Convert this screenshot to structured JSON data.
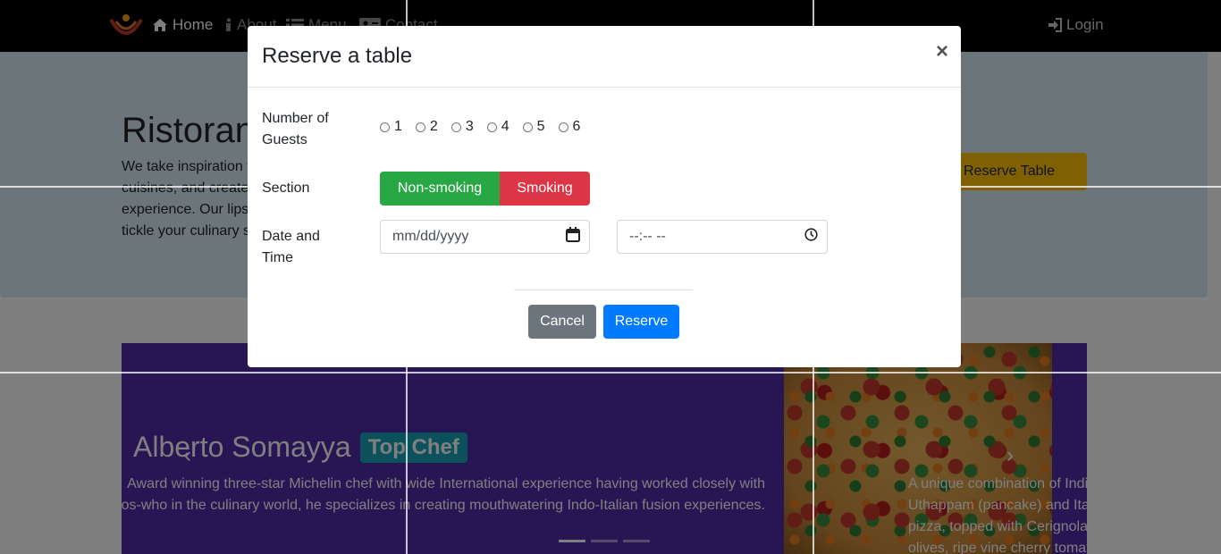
{
  "navbar": {
    "logo_icon": "restaurant-logo-icon",
    "items": [
      {
        "label": "Home",
        "icon": "home-icon"
      },
      {
        "label": "About",
        "icon": "info-icon"
      },
      {
        "label": "Menu",
        "icon": "list-icon"
      },
      {
        "label": "Contact",
        "icon": "address-card-icon"
      }
    ],
    "login": {
      "label": "Login",
      "icon": "sign-in-icon"
    }
  },
  "jumbotron": {
    "title": "Ristorante con Fusion",
    "text": "We take inspiration from the World's best cuisines, and create a unique fusion experience. Our lipsmacking creations will tickle your culinary senses!",
    "button_label": "Reserve Table",
    "button_color": "#ffc107"
  },
  "carousel": {
    "chef_name": "Alberto Somayya",
    "chef_badge": "Top Chef",
    "chef_description": "Award winning three-star Michelin chef with wide International experience having worked closely with whos-who in the culinary world, he specializes in creating mouthwatering Indo-Italian fusion experiences.",
    "next_slide_text": "A unique combination of Indian Uthappam (pancake) and Italian pizza, topped with Cerignola olives, ripe vine cherry tomatoes",
    "indicator_count": 3,
    "active_indicator": 1,
    "background_color": "#512da8"
  },
  "modal": {
    "title": "Reserve a table",
    "close_label": "×",
    "guests": {
      "label": "Number of Guests",
      "options": [
        "1",
        "2",
        "3",
        "4",
        "5",
        "6"
      ]
    },
    "section": {
      "label": "Section",
      "options": [
        "Non-smoking",
        "Smoking"
      ],
      "colors": {
        "Non-smoking": "#28a745",
        "Smoking": "#dc3545"
      }
    },
    "datetime": {
      "label": "Date and Time",
      "date_placeholder": "mm/dd/yyyy",
      "date_icon": "calendar-icon",
      "time_placeholder": "--:-- --",
      "time_icon": "clock-icon"
    },
    "buttons": {
      "cancel": "Cancel",
      "reserve": "Reserve"
    },
    "colors": {
      "cancel": "#6c757d",
      "reserve": "#007bff"
    }
  }
}
